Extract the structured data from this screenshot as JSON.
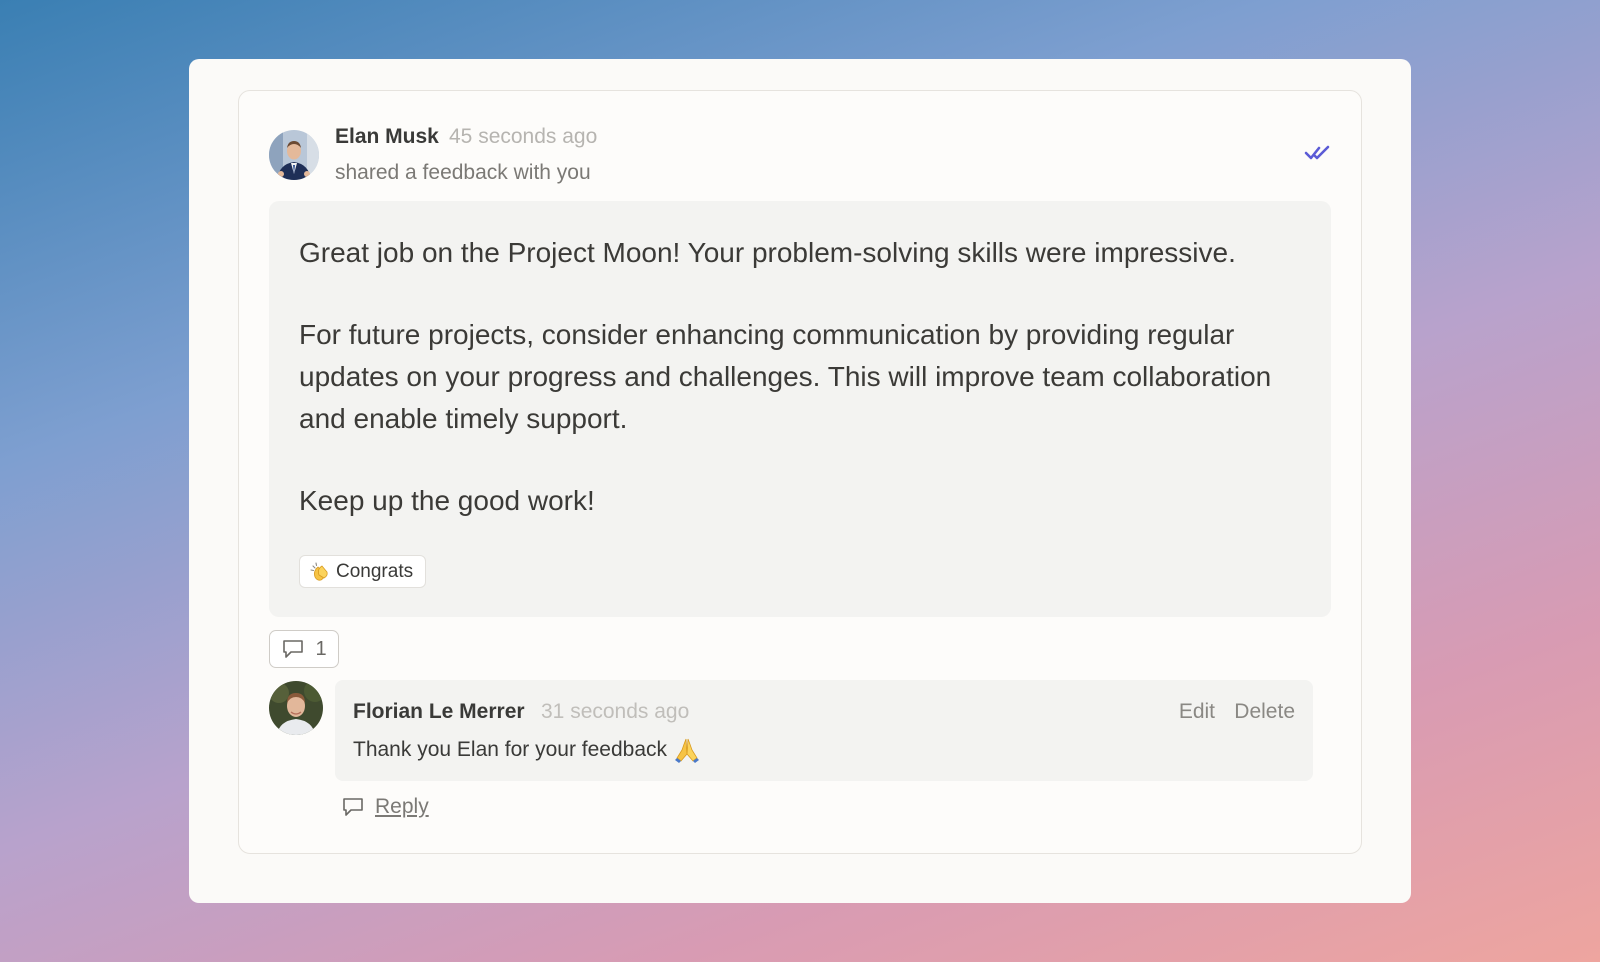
{
  "post": {
    "author": "Elan Musk",
    "time": "45 seconds ago",
    "action": "shared a feedback with you",
    "paragraphs": [
      "Great job on the Project Moon! Your problem-solving skills were impressive.",
      "For future projects, consider enhancing communication by providing regular updates on your progress and challenges. This will improve team collaboration and enable timely support.",
      "Keep up the good work!"
    ],
    "tag": {
      "emoji": "clapping-hands-icon",
      "label": "Congrats"
    },
    "seen_icon": "double-check-icon",
    "accent_color": "#5b5bd6"
  },
  "comments": {
    "count": "1",
    "icon": "speech-bubble-icon"
  },
  "reply": {
    "author": "Florian Le Merrer",
    "time": "31 seconds ago",
    "text": "Thank you Elan for your feedback",
    "emoji": "folded-hands-icon",
    "edit_label": "Edit",
    "delete_label": "Delete"
  },
  "reply_action": {
    "label": "Reply",
    "icon": "speech-bubble-icon"
  }
}
